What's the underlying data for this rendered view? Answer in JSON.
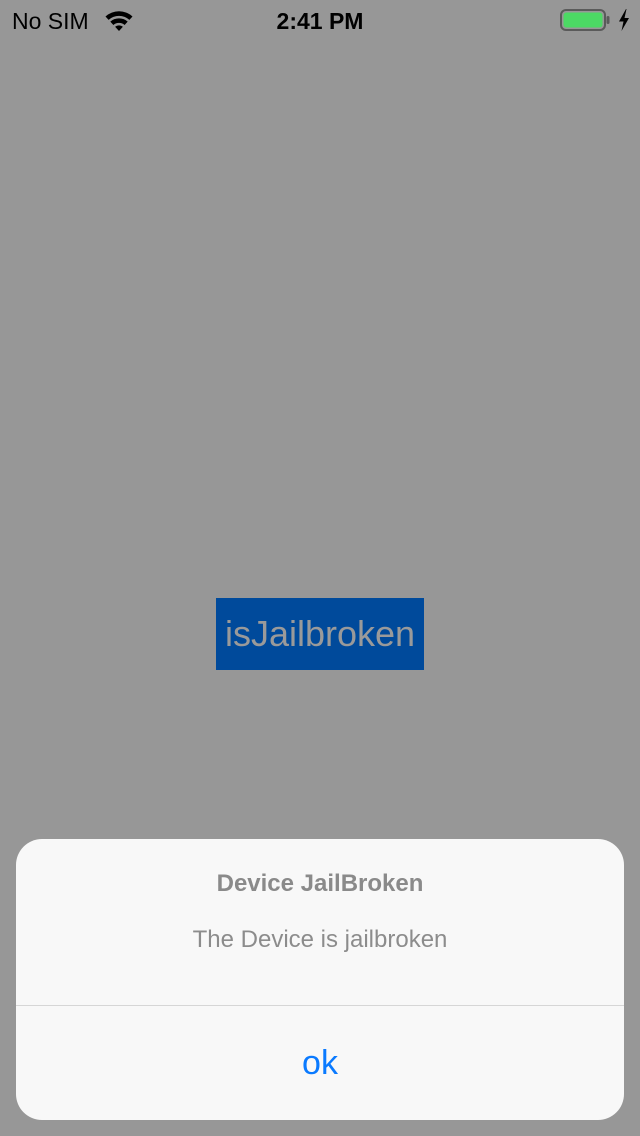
{
  "status_bar": {
    "carrier": "No SIM",
    "time": "2:41 PM",
    "icons": {
      "wifi": "wifi-icon",
      "battery": "battery-icon",
      "charging": "charging-bolt-icon"
    },
    "battery_level": 1.0,
    "battery_color": "#4cd964"
  },
  "main": {
    "button_label": "isJailbroken",
    "button_bg": "#004a9b"
  },
  "alert": {
    "title": "Device JailBroken",
    "message": "The Device is jailbroken",
    "action_label": "ok",
    "action_color": "#0a7aff"
  },
  "colors": {
    "dimmed_background": "#979797",
    "alert_background": "#f8f8f8"
  }
}
